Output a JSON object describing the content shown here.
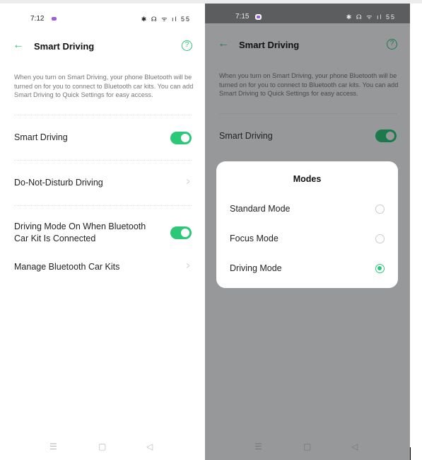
{
  "left_screen": {
    "status_bar": {
      "time": "7:12",
      "icons": "✱ ☊ ᯤ ıl 55"
    },
    "header": {
      "title": "Smart Driving",
      "back_icon": "←",
      "help_icon": "?"
    },
    "description": "When you turn on Smart Driving, your phone Bluetooth will be turned on for you to connect to Bluetooth car kits. You can add Smart Driving to Quick Settings for easy access.",
    "items": [
      {
        "label": "Smart Driving",
        "type": "toggle",
        "on": true
      },
      {
        "label": "Do-Not-Disturb Driving",
        "type": "link"
      },
      {
        "label": "Driving Mode On When Bluetooth Car Kit Is Connected",
        "type": "toggle",
        "on": true
      },
      {
        "label": "Manage Bluetooth Car Kits",
        "type": "link"
      }
    ],
    "nav": {
      "menu": "☰",
      "home": "▢",
      "back": "◁"
    }
  },
  "right_screen": {
    "status_bar": {
      "time": "7:15",
      "icons": "✱ ☊ ᯤ ıl 55"
    },
    "header": {
      "title": "Smart Driving",
      "back_icon": "←",
      "help_icon": "?"
    },
    "description": "When you turn on Smart Driving, your phone Bluetooth will be turned on for you to connect to Bluetooth car kits. You can add Smart Driving to Quick Settings for easy access.",
    "smart_driving": {
      "label": "Smart Driving",
      "on": true
    },
    "modal": {
      "title": "Modes",
      "options": [
        {
          "label": "Standard Mode",
          "selected": false
        },
        {
          "label": "Focus Mode",
          "selected": false
        },
        {
          "label": "Driving Mode",
          "selected": true
        }
      ]
    },
    "nav": {
      "menu": "☰",
      "home": "▢",
      "back": "◁"
    }
  },
  "colors": {
    "accent": "#2bc878",
    "dim_overlay": "#97989a"
  }
}
